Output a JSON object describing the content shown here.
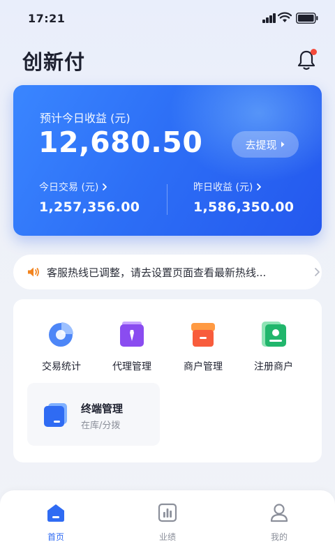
{
  "status_bar": {
    "time": "17:21"
  },
  "header": {
    "app_title": "创新付",
    "notification_icon": "bell-icon"
  },
  "earnings_card": {
    "label": "预计今日收益 (元)",
    "amount": "12,680.50",
    "withdraw_label": "去提现",
    "stats": [
      {
        "label": "今日交易 (元)",
        "value": "1,257,356.00"
      },
      {
        "label": "昨日收益 (元)",
        "value": "1,586,350.00"
      }
    ]
  },
  "notice": {
    "icon": "speaker-icon",
    "text": "客服热线已调整，请去设置页面查看最新热线..."
  },
  "functions": [
    {
      "label": "交易统计",
      "icon": "pie-chart-icon"
    },
    {
      "label": "代理管理",
      "icon": "id-badge-icon"
    },
    {
      "label": "商户管理",
      "icon": "store-icon"
    },
    {
      "label": "注册商户",
      "icon": "register-icon"
    }
  ],
  "terminal": {
    "title": "终端管理",
    "subtitle": "在库/分拨",
    "icon": "terminal-icon"
  },
  "bottom_nav": [
    {
      "label": "首页",
      "icon": "home-icon",
      "active": true
    },
    {
      "label": "业绩",
      "icon": "bar-chart-icon",
      "active": false
    },
    {
      "label": "我的",
      "icon": "user-icon",
      "active": false
    }
  ],
  "colors": {
    "primary": "#2f6bf3",
    "notice_accent": "#f2841f",
    "badge": "#f44a3a"
  }
}
